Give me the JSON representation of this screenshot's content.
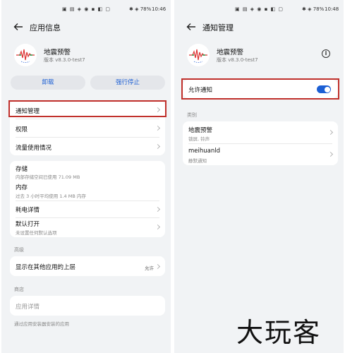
{
  "left": {
    "status_icons": "▣ ▤ ◈ ◉ ▪ ◧ ▢",
    "battery": "✱ ◈ 78%",
    "time": "10:46",
    "title": "应用信息",
    "app_name": "地震预警",
    "app_version": "版本 v8.3.0-test7",
    "uninstall_label": "卸载",
    "force_stop_label": "强行停止",
    "notification_mgmt": "通知管理",
    "permissions": "权限",
    "data_usage": "流量使用情况",
    "storage": "存储",
    "storage_detail": "内部存储空间已使用 71.09 MB",
    "memory": "内存",
    "memory_detail": "过去 3 小时平均使用 1.4 MB 内存",
    "power_details": "耗电详情",
    "open_by_default": "默认打开",
    "open_by_default_detail": "未设置任何默认选项",
    "section_advanced": "高级",
    "display_over_apps": "显示在其他应用的上层",
    "display_over_apps_value": "允许",
    "section_store": "商店",
    "app_details": "应用详情",
    "install_source": "通过应用安装器安装的应用"
  },
  "right": {
    "status_icons": "▣ ▤ ◈ ◉ ▪ ◧ ▢",
    "battery": "✱ ◈ 78%",
    "time": "10:48",
    "title": "通知管理",
    "app_name": "地震预警",
    "app_version": "版本 v8.3.0-test7",
    "allow_notifications": "允许通知",
    "allow_notifications_on": true,
    "section_categories": "类别",
    "category1_name": "地震预警",
    "category1_detail": "锁屏, 铃声",
    "category2_name": "meihuanld",
    "category2_detail": "静默通知"
  },
  "watermark": "大玩客",
  "colors": {
    "accent": "#1c5fd4",
    "highlight_box": "#c0302b",
    "background": "#f1f3f5"
  },
  "icons": [
    "back-arrow-icon",
    "info-icon",
    "chevron-right-icon",
    "app-logo-icon",
    "toggle-switch"
  ]
}
